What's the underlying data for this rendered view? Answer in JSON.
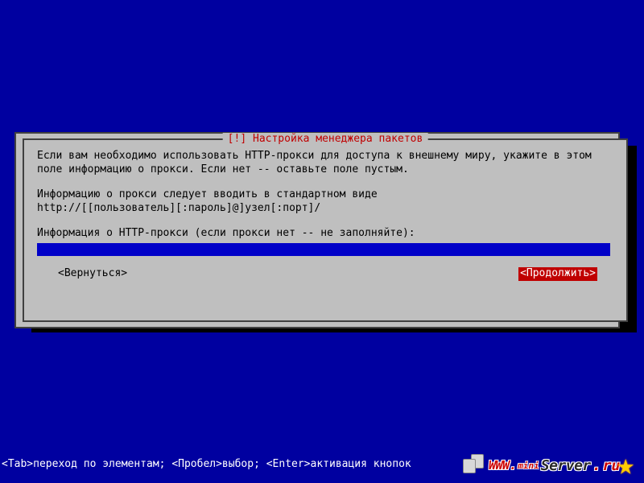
{
  "dialog": {
    "title": "[!] Настройка менеджера пакетов",
    "para1": "Если вам необходимо использовать HTTP-прокси для доступа к внешнему миру, укажите в этом поле информацию о прокси. Если нет -- оставьте поле пустым.",
    "para2a": "Информацию о прокси следует вводить в стандартном виде",
    "para2b": "http://[[пользователь][:пароль]@]узел[:порт]/",
    "prompt": "Информация о HTTP-прокси (если прокси нет -- не заполняйте):",
    "input_value": "",
    "back": "<Вернуться>",
    "continue": "<Продолжить>"
  },
  "hint": "<Tab>переход по элементам; <Пробел>выбор; <Enter>активация кнопок",
  "watermark": {
    "www": "WWW.",
    "mini": "mini",
    "server": "Server",
    "dot": ".",
    "ru": "ru"
  }
}
